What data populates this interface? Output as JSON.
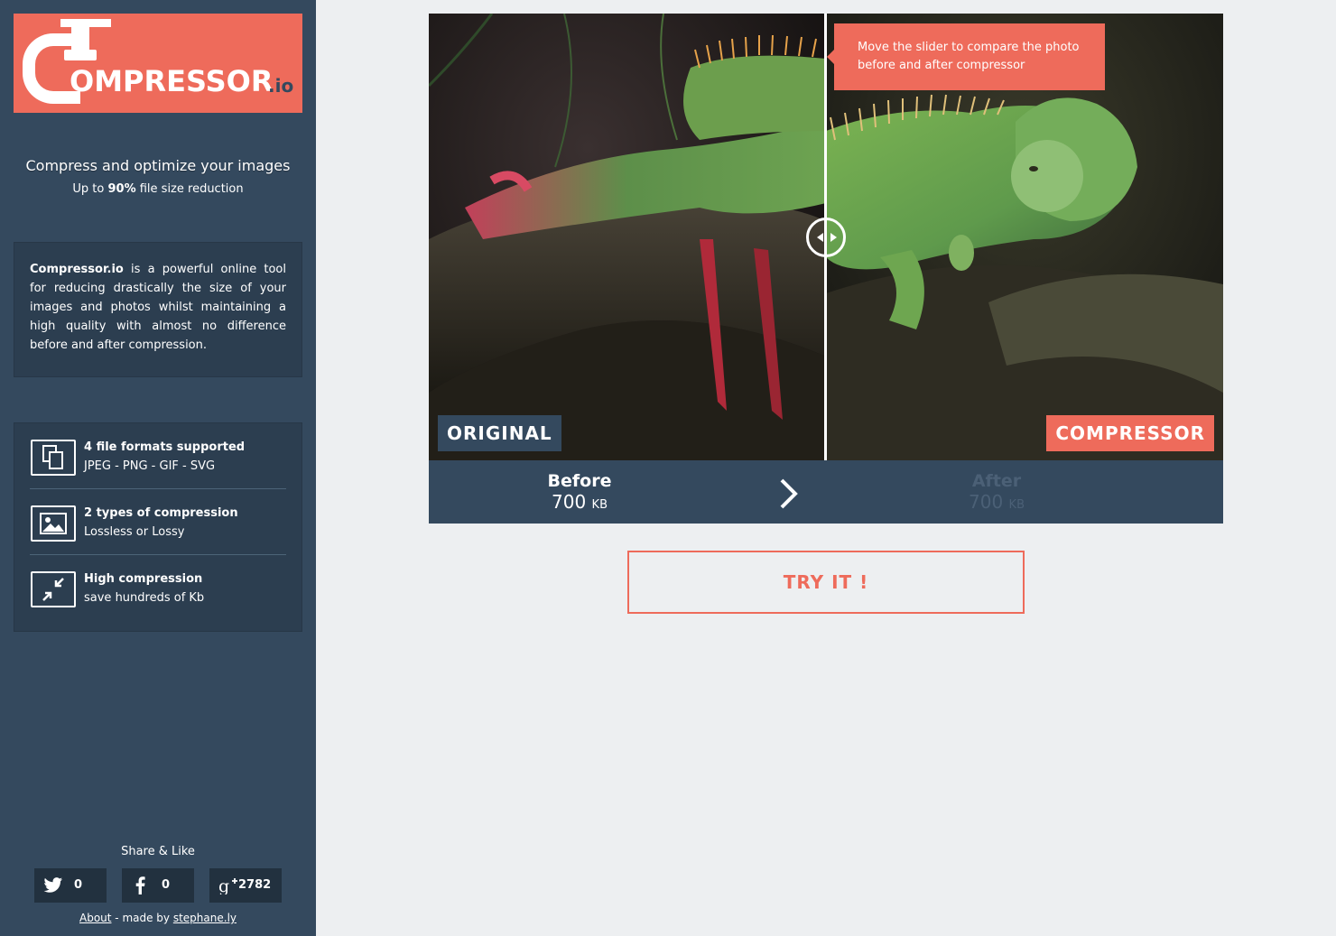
{
  "brand": {
    "logo_text": "OMPRESSOR",
    "logo_tld": ".io",
    "accent": "#ee6b5b",
    "sidebar_bg": "#34495e"
  },
  "sidebar": {
    "tagline": "Compress and optimize your images",
    "subtag_prefix": "Up to ",
    "subtag_percent": "90%",
    "subtag_suffix": " file size reduction",
    "about_brand": "Compressor.io",
    "about_text": " is a powerful online tool for reducing drastically the size of your images and photos whilst maintaining a high quality with almost no difference before and after compression.",
    "features": [
      {
        "icon": "files-icon",
        "title": "4 file formats supported",
        "sub": "JPEG - PNG - GIF - SVG"
      },
      {
        "icon": "image-icon",
        "title": "2 types of compression",
        "sub": "Lossless or Lossy"
      },
      {
        "icon": "compress-icon",
        "title": "High compression",
        "sub": "save hundreds of Kb"
      }
    ],
    "share_title": "Share & Like",
    "share": [
      {
        "icon": "twitter-icon",
        "count": "0"
      },
      {
        "icon": "facebook-icon",
        "count": "0"
      },
      {
        "icon": "google-plus-icon",
        "count": "2782"
      }
    ],
    "footer": {
      "about": "About",
      "made_by": " - made by ",
      "author": "stephane.ly"
    }
  },
  "compare": {
    "tooltip": "Move the slider to compare the photo before and after compressor",
    "label_original": "ORIGINAL",
    "label_compressor": "COMPRESSOR"
  },
  "stats": {
    "before_label": "Before",
    "before_value": "700",
    "before_unit": "KB",
    "after_label": "After",
    "after_value": "700",
    "after_unit": "KB"
  },
  "cta": {
    "label": "TRY IT !"
  }
}
